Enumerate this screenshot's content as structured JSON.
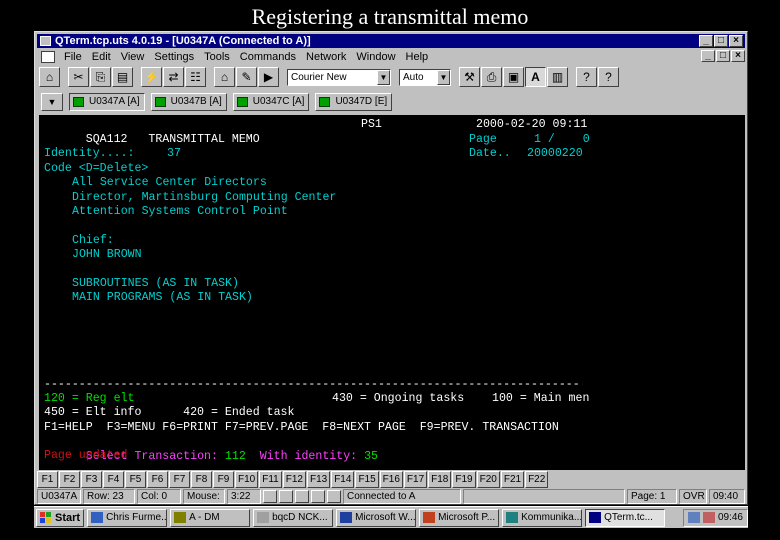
{
  "slide": {
    "title": "Registering a transmittal memo"
  },
  "window": {
    "title": "QTerm.tcp.uts 4.0.19 - [U0347A (Connected to A)]",
    "controls": [
      "_",
      "_",
      "×"
    ]
  },
  "menu": [
    "File",
    "Edit",
    "View",
    "Settings",
    "Tools",
    "Commands",
    "Network",
    "Window",
    "Help"
  ],
  "toolbar": {
    "font": "Courier New",
    "size": "Auto"
  },
  "sessions": [
    "U0347A [A]",
    "U0347B [A]",
    "U0347C [A]",
    "U0347D [E]"
  ],
  "screen": {
    "form_id": "SQA112",
    "form_title": "TRANSMITTAL MEMO",
    "ps": "PS1",
    "datetime": "2000-02-20 09:11",
    "page_label": "Page",
    "page_value": "1 /    0",
    "date_label": "Date..",
    "date_value": "20000220",
    "identity_label": "Identity....:",
    "identity_value": "37",
    "code_label": "Code <D=Delete>",
    "recipients": [
      "All Service Center Directors",
      "Director, Martinsburg Computing Center",
      "Attention Systems Control Point"
    ],
    "chief_label": "Chief:",
    "chief_name": "JOHN BROWN",
    "refs": [
      "SUBROUTINES (AS IN TASK)",
      "MAIN PROGRAMS (AS IN TASK)"
    ],
    "divider": "-----------------------------------------------------------------------------",
    "opt_row1_left": "120 = Reg elt",
    "opt_row1_right": "430 = Ongoing tasks    100 = Main men",
    "opt_row2": "450 = Elt info      420 = Ended task",
    "keys_row": "F1=HELP  F3=MENU F6=PRINT F7=PREV.PAGE  F8=NEXT PAGE  F9=PREV. TRANSACTION",
    "select_label": "Select Transaction:",
    "select_value": "112",
    "with_label": "With identity:",
    "with_value": "35",
    "message": "Page updated"
  },
  "fkeys": [
    "F1",
    "F2",
    "F3",
    "F4",
    "F5",
    "F6",
    "F7",
    "F8",
    "F9",
    "F10",
    "F11",
    "F12",
    "F13",
    "F14",
    "F15",
    "F16",
    "F17",
    "F18",
    "F19",
    "F20",
    "F21",
    "F22"
  ],
  "status": {
    "session": "U0347A",
    "row": "Row: 23",
    "col": "Col: 0",
    "mouse": "Mouse:",
    "mouse_pos": "3:22",
    "connection": "Connected to A",
    "page": "Page: 1",
    "mode": "OVR",
    "time": "09:40"
  },
  "taskbar": {
    "start": "Start",
    "items": [
      "Chris Furme...",
      "A - DM",
      "bqcD NCK...",
      "Microsoft W...",
      "Microsoft P...",
      "Kommunika...",
      "QTerm.tc..."
    ],
    "clock": "09:46"
  }
}
